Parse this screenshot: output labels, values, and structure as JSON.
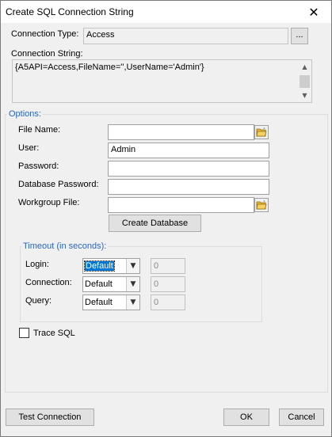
{
  "window": {
    "title": "Create SQL Connection String",
    "close_glyph": "✕"
  },
  "connection_type": {
    "label": "Connection Type:",
    "value": "Access",
    "browse_label": "..."
  },
  "connection_string": {
    "label": "Connection String:",
    "value": "{A5API=Access,FileName='',UserName='Admin'}"
  },
  "options": {
    "legend": "Options:",
    "file_name": {
      "label": "File Name:",
      "value": ""
    },
    "user": {
      "label": "User:",
      "value": "Admin"
    },
    "password": {
      "label": "Password:",
      "value": ""
    },
    "database_password": {
      "label": "Database Password:",
      "value": ""
    },
    "workgroup_file": {
      "label": "Workgroup File:",
      "value": ""
    },
    "create_database_label": "Create Database"
  },
  "timeout": {
    "legend": "Timeout (in seconds):",
    "rows": [
      {
        "label": "Login:",
        "mode": "Default",
        "value": "0"
      },
      {
        "label": "Connection:",
        "mode": "Default",
        "value": "0"
      },
      {
        "label": "Query:",
        "mode": "Default",
        "value": "0"
      }
    ]
  },
  "trace_sql": {
    "label": "Trace SQL",
    "checked": false
  },
  "footer": {
    "test_connection_label": "Test Connection",
    "ok_label": "OK",
    "cancel_label": "Cancel"
  },
  "colors": {
    "legend_text": "#2a66c2",
    "selection": "#0078d7",
    "folder_icon": "#e8b830"
  },
  "icons": {
    "close": "close-icon",
    "folder": "open-folder-icon",
    "dropdown": "chevron-down-icon"
  }
}
